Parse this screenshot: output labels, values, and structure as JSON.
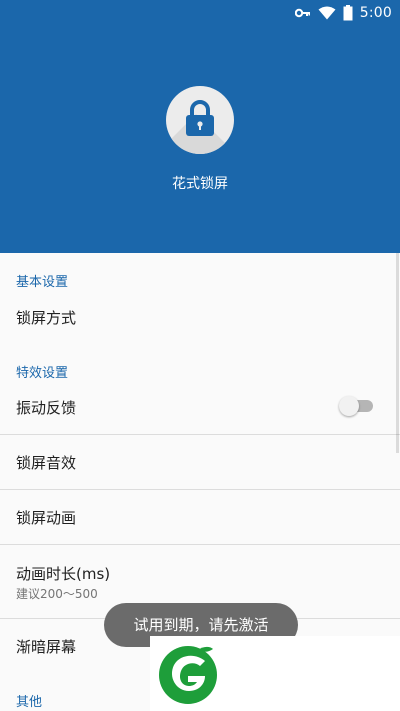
{
  "status_bar": {
    "time": "5:00",
    "icons": [
      "key-icon",
      "wifi-icon",
      "battery-icon"
    ]
  },
  "header": {
    "app_name": "花式锁屏",
    "icon": "lock-icon",
    "color": "#1b67ab"
  },
  "sections": {
    "basic": {
      "title": "基本设置",
      "items": {
        "lock_mode": "锁屏方式"
      }
    },
    "effects": {
      "title": "特效设置",
      "items": {
        "vibration": "振动反馈",
        "vibration_enabled": false,
        "sound": "锁屏音效",
        "animation": "锁屏动画",
        "duration": "动画时长(ms)",
        "duration_hint": "建议200～500",
        "fade": "渐暗屏幕"
      }
    },
    "other": {
      "title": "其他"
    }
  },
  "toast": {
    "message": "试用到期，请先激活"
  },
  "watermark": {
    "icon": "green-leaf-logo-icon"
  },
  "colors": {
    "accent": "#1b67ab",
    "toast_bg": "#6b6b6b",
    "logo_green": "#1e9e3a"
  }
}
